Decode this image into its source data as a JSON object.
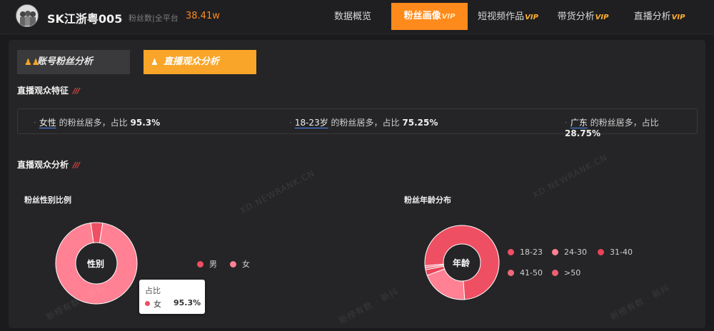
{
  "header": {
    "account_name": "SK江浙粤005",
    "fans_label": "粉丝数|全平台",
    "fans_value": "38.41w",
    "nav": [
      {
        "label": "数据概览",
        "vip": ""
      },
      {
        "label": "粉丝画像",
        "vip": "VIP"
      },
      {
        "label": "短视频作品",
        "vip": "VIP"
      },
      {
        "label": "带货分析",
        "vip": "VIP"
      },
      {
        "label": "直播分析",
        "vip": "VIP"
      }
    ],
    "active_nav": 1
  },
  "tabs": {
    "account_fans": "账号粉丝分析",
    "live_audience": "直播观众分析"
  },
  "features": {
    "title": "直播观众特征",
    "items": [
      {
        "key": "女性",
        "text": "的粉丝居多，占比",
        "pct": "95.3%"
      },
      {
        "key": "18-23岁",
        "text": "的粉丝居多，占比",
        "pct": "75.25%"
      },
      {
        "key": "广东",
        "text": "的粉丝居多，占比",
        "pct": "28.75%"
      }
    ]
  },
  "analysis": {
    "title": "直播观众分析"
  },
  "chart_data": [
    {
      "type": "pie",
      "title": "粉丝性别比例",
      "center_label": "性别",
      "categories": [
        "男",
        "女"
      ],
      "values": [
        4.7,
        95.3
      ],
      "colors": [
        "#ef4f63",
        "#ff8193"
      ],
      "tooltip": {
        "title": "占比",
        "label": "女",
        "value": "95.3%"
      }
    },
    {
      "type": "pie",
      "title": "粉丝年龄分布",
      "center_label": "年龄",
      "categories": [
        "18-23",
        "24-30",
        "31-40",
        "41-50",
        ">50"
      ],
      "values": [
        75.25,
        20.5,
        2.5,
        1.0,
        0.75
      ],
      "colors": [
        "#ef4f63",
        "#ff8193",
        "#e94458",
        "#f06a7a",
        "#ef5f71"
      ]
    }
  ],
  "watermarks": [
    "XD.NEWRANK.CN",
    "新榜有数 · 新抖"
  ],
  "colors": {
    "accent": "#ff8a1c",
    "tab_active": "#f8a529",
    "pie_main": "#ef4f63",
    "pie_light": "#ff8193"
  }
}
